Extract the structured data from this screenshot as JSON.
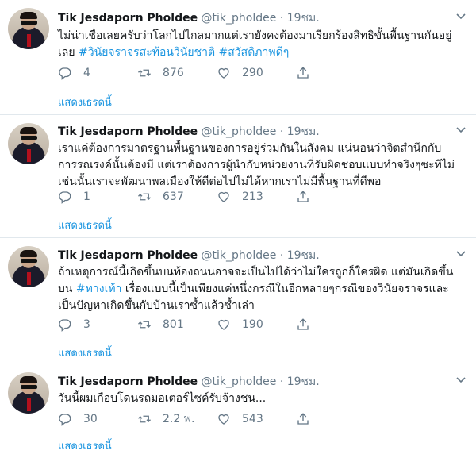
{
  "tweets": [
    {
      "name": "Tik Jesdaporn Pholdee",
      "handle": "@tik_pholdee",
      "dot": "·",
      "time": "19ชม.",
      "text_plain": "ไม่น่าเชื่อเลยครับว่าโลกไปไกลมากแต่เรายังคงต้องมาเรียกร้องสิทธิขั้นพื้นฐานกันอยู่เลย ",
      "hashtags": [
        "#วินัยจราจรสะท้อนวินัยชาติ",
        "#สวัสดิภาพดีๆ"
      ],
      "replies": "4",
      "retweets": "876",
      "likes": "290",
      "thread_link": "แสดงเธรดนี้"
    },
    {
      "name": "Tik Jesdaporn Pholdee",
      "handle": "@tik_pholdee",
      "dot": "·",
      "time": "19ชม.",
      "text_plain": "เราแค่ต้องการมาตรฐานพื้นฐานของการอยู่ร่วมกันในสังคม แน่นอนว่าจิตสำนึกกับการรณรงค์นั้นต้องมี แต่เราต้องการผู้นำกับหน่วยงานที่รับผิดชอบแบบทำจริงๆซะทีไม่เช่นนั้นเราจะพัฒนาพลเมืองให้ดีต่อไปไม่ได้หากเราไม่มีพื้นฐานที่ดีพอ",
      "replies": "1",
      "retweets": "637",
      "likes": "213",
      "thread_link": "แสดงเธรดนี้"
    },
    {
      "name": "Tik Jesdaporn Pholdee",
      "handle": "@tik_pholdee",
      "dot": "·",
      "time": "19ชม.",
      "text_before": "ถ้าเหตุการณ์นี้เกิดขึ้นบนท้องถนนอาจจะเป็นไปได้ว่าไม่ใครถูกก็ใครผิด แต่มันเกิดขึ้นบน ",
      "hashtag": "#ทางเท้า",
      "text_after": " เรื่องแบบนี้เป็นเพียงแค่หนึ่งกรณีในอีกหลายๆกรณีของวินัยจราจรและเป็นปัญหาเกิดขึ้นกับบ้านเราซ้ำแล้วซ้ำเล่า",
      "replies": "3",
      "retweets": "801",
      "likes": "190",
      "thread_link": "แสดงเธรดนี้"
    },
    {
      "name": "Tik Jesdaporn Pholdee",
      "handle": "@tik_pholdee",
      "dot": "·",
      "time": "19ชม.",
      "text_plain": "วันนี้ผมเกือบโดนรถมอเตอร์ไซค์รับจ้างชน...",
      "replies": "30",
      "retweets": "2.2 พ.",
      "likes": "543",
      "thread_link": "แสดงเธรดนี้"
    }
  ],
  "colors": {
    "link": "#1b95e0",
    "muted": "#657786",
    "divider": "#e1e8ed"
  },
  "icons": [
    "reply-icon",
    "retweet-icon",
    "like-icon",
    "share-icon",
    "caret-down-icon"
  ]
}
